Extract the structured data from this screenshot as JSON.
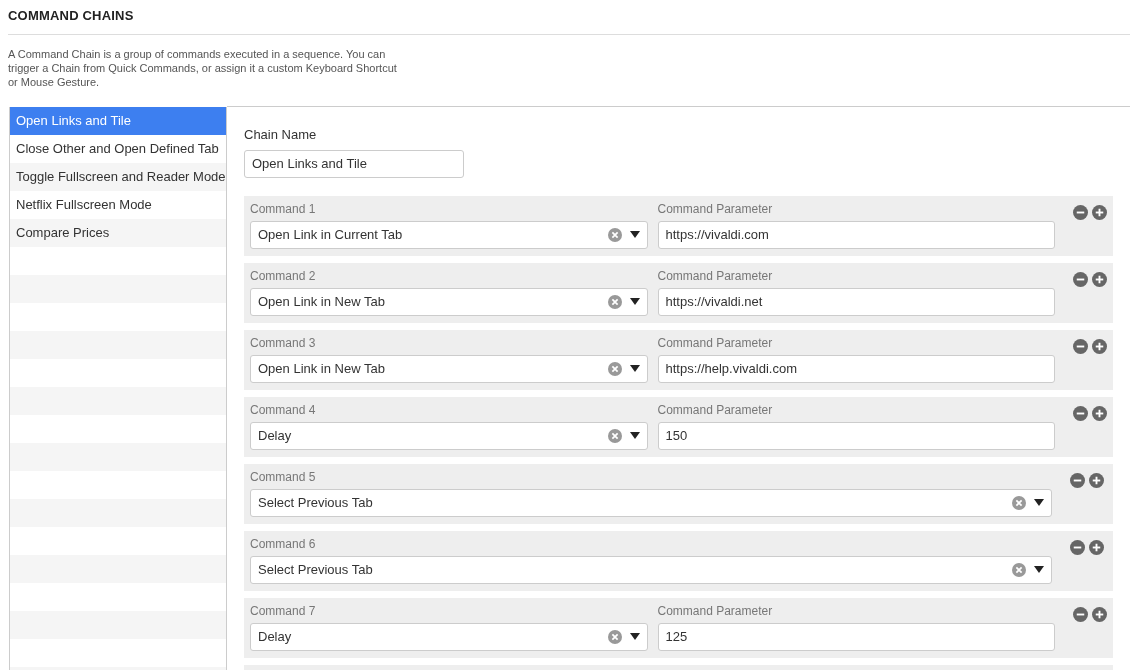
{
  "title": "COMMAND CHAINS",
  "description": "A Command Chain is a group of commands executed in a sequence. You can trigger a Chain from Quick Commands, or assign it a custom Keyboard Shortcut or Mouse Gesture.",
  "chains": [
    {
      "label": "Open Links and Tile",
      "selected": true
    },
    {
      "label": "Close Other and Open Defined Tab",
      "selected": false
    },
    {
      "label": "Toggle Fullscreen and Reader Mode",
      "selected": false
    },
    {
      "label": "Netflix Fullscreen Mode",
      "selected": false
    },
    {
      "label": "Compare Prices",
      "selected": false
    }
  ],
  "chain_name": {
    "label": "Chain Name",
    "value": "Open Links and Tile"
  },
  "commands": [
    {
      "kind": "with_param",
      "label": "Command 1",
      "command": "Open Link in Current Tab",
      "param_label": "Command Parameter",
      "param": "https://vivaldi.com"
    },
    {
      "kind": "with_param",
      "label": "Command 2",
      "command": "Open Link in New Tab",
      "param_label": "Command Parameter",
      "param": "https://vivaldi.net"
    },
    {
      "kind": "with_param",
      "label": "Command 3",
      "command": "Open Link in New Tab",
      "param_label": "Command Parameter",
      "param": "https://help.vivaldi.com"
    },
    {
      "kind": "with_param",
      "label": "Command 4",
      "command": "Delay",
      "param_label": "Command Parameter",
      "param": "150"
    },
    {
      "kind": "plain",
      "label": "Command 5",
      "command": "Select Previous Tab"
    },
    {
      "kind": "plain",
      "label": "Command 6",
      "command": "Select Previous Tab"
    },
    {
      "kind": "with_param",
      "label": "Command 7",
      "command": "Delay",
      "param_label": "Command Parameter",
      "param": "125"
    }
  ]
}
